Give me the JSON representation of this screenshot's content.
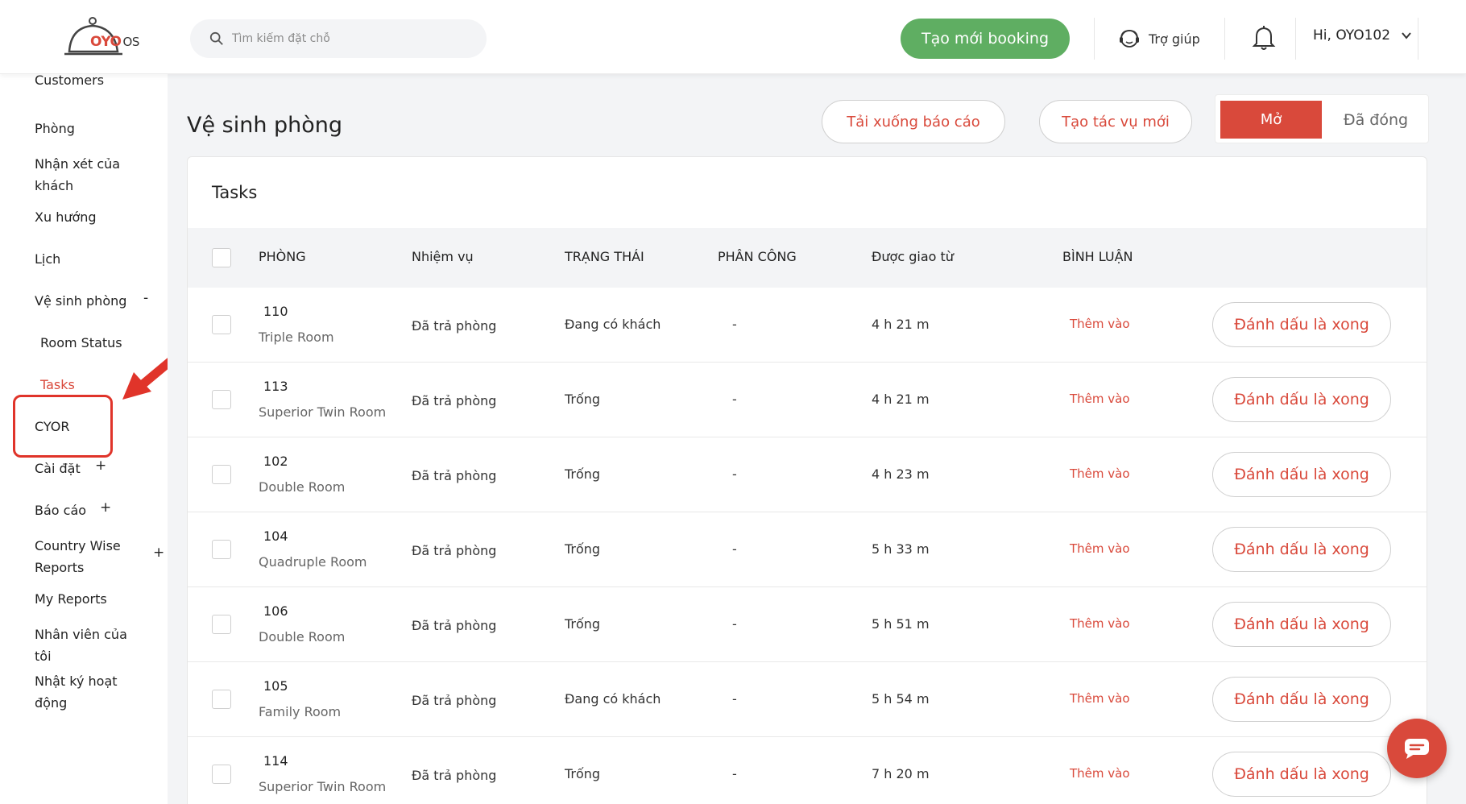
{
  "header": {
    "logo_text": "OYO",
    "logo_suffix": "OS",
    "search_placeholder": "Tìm kiếm đặt chỗ",
    "new_booking_label": "Tạo mới booking",
    "help_label": "Trợ giúp",
    "user_label": "Hi, OYO102",
    "colors": {
      "brand": "#d9493b",
      "booking_button": "#5fae62"
    }
  },
  "sidebar": {
    "items": [
      {
        "label": "Customers"
      },
      {
        "label": "Phòng"
      },
      {
        "label": "Nhận xét của",
        "label2": "khách"
      },
      {
        "label": "Xu hướng"
      },
      {
        "label": "Lịch"
      },
      {
        "label": "Vệ sinh phòng",
        "sign": "-"
      },
      {
        "label": "Room Status"
      },
      {
        "label": "Tasks"
      },
      {
        "label": "CYOR"
      },
      {
        "label": "Cài đặt",
        "sign": "+"
      },
      {
        "label": "Báo cáo",
        "sign": "+"
      },
      {
        "label": "Country Wise",
        "label2": "Reports",
        "sign": "+"
      },
      {
        "label": "My Reports"
      },
      {
        "label": "Nhân viên của",
        "label2": "tôi"
      },
      {
        "label": "Nhật ký hoạt",
        "label2": "động"
      }
    ]
  },
  "page": {
    "title": "Vệ sinh phòng",
    "download_report_label": "Tải xuống báo cáo",
    "new_task_label": "Tạo tác vụ mới",
    "toggle_open_label": "Mở",
    "toggle_closed_label": "Đã đóng"
  },
  "table": {
    "title": "Tasks",
    "headers": [
      "PHÒNG",
      "Nhiệm vụ",
      "TRẠNG THÁI",
      "PHÂN CÔNG",
      "Được giao từ",
      "BÌNH LUẬN"
    ],
    "rows": [
      {
        "room": "110",
        "type": "Triple Room",
        "task": "Đã trả phòng",
        "status": "Đang có khách",
        "assign": "-",
        "since": "4 h 21 m",
        "comment": "Thêm vào",
        "action": "Đánh dấu là xong"
      },
      {
        "room": "113",
        "type": "Superior Twin Room",
        "task": "Đã trả phòng",
        "status": "Trống",
        "assign": "-",
        "since": "4 h 21 m",
        "comment": "Thêm vào",
        "action": "Đánh dấu là xong"
      },
      {
        "room": "102",
        "type": "Double Room",
        "task": "Đã trả phòng",
        "status": "Trống",
        "assign": "-",
        "since": "4 h 23 m",
        "comment": "Thêm vào",
        "action": "Đánh dấu là xong"
      },
      {
        "room": "104",
        "type": "Quadruple Room",
        "task": "Đã trả phòng",
        "status": "Trống",
        "assign": "-",
        "since": "5 h 33 m",
        "comment": "Thêm vào",
        "action": "Đánh dấu là xong"
      },
      {
        "room": "106",
        "type": "Double Room",
        "task": "Đã trả phòng",
        "status": "Trống",
        "assign": "-",
        "since": "5 h 51 m",
        "comment": "Thêm vào",
        "action": "Đánh dấu là xong"
      },
      {
        "room": "105",
        "type": "Family Room",
        "task": "Đã trả phòng",
        "status": "Đang có khách",
        "assign": "-",
        "since": "5 h 54 m",
        "comment": "Thêm vào",
        "action": "Đánh dấu là xong"
      },
      {
        "room": "114",
        "type": "Superior Twin Room",
        "task": "Đã trả phòng",
        "status": "Trống",
        "assign": "-",
        "since": "7 h 20 m",
        "comment": "Thêm vào",
        "action": "Đánh dấu là xong"
      }
    ]
  }
}
